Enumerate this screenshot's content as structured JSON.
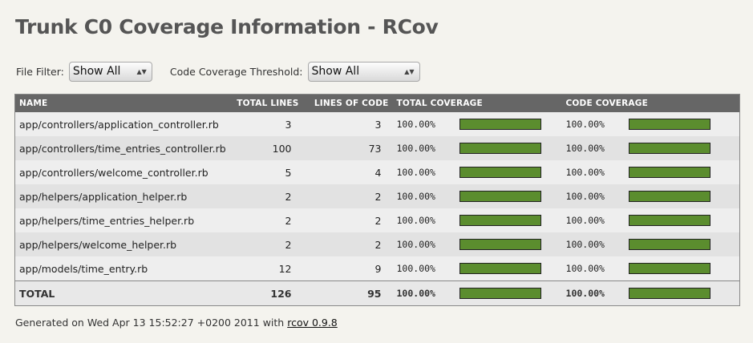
{
  "title": "Trunk C0 Coverage Information - RCov",
  "filters": {
    "file_filter_label": "File Filter:",
    "file_filter_value": "Show All",
    "threshold_label": "Code Coverage Threshold:",
    "threshold_value": "Show All"
  },
  "table": {
    "headers": [
      "NAME",
      "TOTAL LINES",
      "LINES OF CODE",
      "TOTAL COVERAGE",
      "CODE COVERAGE"
    ],
    "rows": [
      {
        "name": "app/controllers/application_controller.rb",
        "total_lines": "3",
        "lines_of_code": "3",
        "total_coverage": "100.00%",
        "total_coverage_value": 100,
        "code_coverage": "100.00%",
        "code_coverage_value": 100
      },
      {
        "name": "app/controllers/time_entries_controller.rb",
        "total_lines": "100",
        "lines_of_code": "73",
        "total_coverage": "100.00%",
        "total_coverage_value": 100,
        "code_coverage": "100.00%",
        "code_coverage_value": 100
      },
      {
        "name": "app/controllers/welcome_controller.rb",
        "total_lines": "5",
        "lines_of_code": "4",
        "total_coverage": "100.00%",
        "total_coverage_value": 100,
        "code_coverage": "100.00%",
        "code_coverage_value": 100
      },
      {
        "name": "app/helpers/application_helper.rb",
        "total_lines": "2",
        "lines_of_code": "2",
        "total_coverage": "100.00%",
        "total_coverage_value": 100,
        "code_coverage": "100.00%",
        "code_coverage_value": 100
      },
      {
        "name": "app/helpers/time_entries_helper.rb",
        "total_lines": "2",
        "lines_of_code": "2",
        "total_coverage": "100.00%",
        "total_coverage_value": 100,
        "code_coverage": "100.00%",
        "code_coverage_value": 100
      },
      {
        "name": "app/helpers/welcome_helper.rb",
        "total_lines": "2",
        "lines_of_code": "2",
        "total_coverage": "100.00%",
        "total_coverage_value": 100,
        "code_coverage": "100.00%",
        "code_coverage_value": 100
      },
      {
        "name": "app/models/time_entry.rb",
        "total_lines": "12",
        "lines_of_code": "9",
        "total_coverage": "100.00%",
        "total_coverage_value": 100,
        "code_coverage": "100.00%",
        "code_coverage_value": 100
      }
    ],
    "total": {
      "name": "TOTAL",
      "total_lines": "126",
      "lines_of_code": "95",
      "total_coverage": "100.00%",
      "total_coverage_value": 100,
      "code_coverage": "100.00%",
      "code_coverage_value": 100
    }
  },
  "footer": {
    "text": "Generated on Wed Apr 13 15:52:27 +0200 2011 with",
    "link_text": "rcov 0.9.8"
  },
  "colors": {
    "bar_fill": "#5b8d2e",
    "header_bg": "#666666"
  }
}
